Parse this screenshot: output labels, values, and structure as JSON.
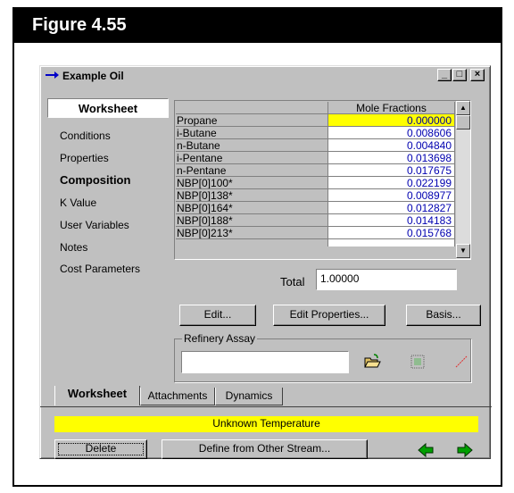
{
  "figure_label": "Figure 4.55",
  "window": {
    "title": "Example Oil",
    "minimize": "_",
    "restore": "□",
    "close": "×"
  },
  "nav": {
    "header": "Worksheet",
    "items": [
      "Conditions",
      "Properties",
      "Composition",
      "K Value",
      "User Variables",
      "Notes",
      "Cost Parameters"
    ],
    "active": "Composition"
  },
  "grid": {
    "column_header": "Mole Fractions",
    "rows": [
      {
        "name": "Propane",
        "value": "0.000000"
      },
      {
        "name": "i-Butane",
        "value": "0.008606"
      },
      {
        "name": "n-Butane",
        "value": "0.004840"
      },
      {
        "name": "i-Pentane",
        "value": "0.013698"
      },
      {
        "name": "n-Pentane",
        "value": "0.017675"
      },
      {
        "name": "NBP[0]100*",
        "value": "0.022199"
      },
      {
        "name": "NBP[0]138*",
        "value": "0.008977"
      },
      {
        "name": "NBP[0]164*",
        "value": "0.012827"
      },
      {
        "name": "NBP[0]188*",
        "value": "0.014183"
      },
      {
        "name": "NBP[0]213*",
        "value": "0.015768"
      }
    ]
  },
  "total": {
    "label": "Total",
    "value": "1.00000"
  },
  "buttons": {
    "edit": "Edit...",
    "edit_properties": "Edit Properties...",
    "basis": "Basis...",
    "delete": "Delete",
    "define_from_other": "Define from Other Stream..."
  },
  "refinery_assay": {
    "label": "Refinery Assay",
    "value": ""
  },
  "tabs": [
    "Worksheet",
    "Attachments",
    "Dynamics"
  ],
  "status": "Unknown Temperature",
  "colors": {
    "status_bg": "#ffff00",
    "selected_cell": "#ffff00",
    "value_text": "#0000b0",
    "arrow": "#008000"
  },
  "icons": [
    "blue-arrow-icon",
    "open-folder-icon",
    "grid-icon",
    "red-line-icon",
    "left-arrow-icon",
    "right-arrow-icon"
  ]
}
